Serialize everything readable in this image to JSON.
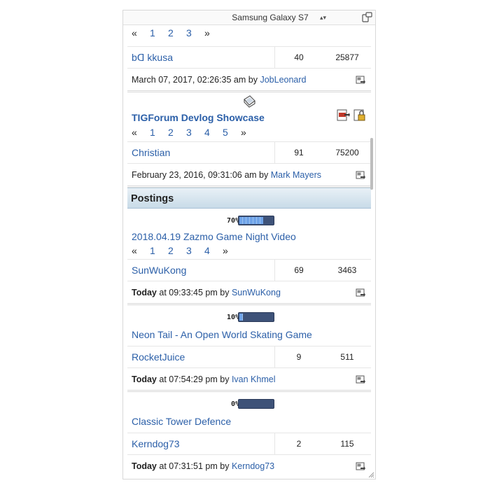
{
  "device": {
    "name": "Samsung Galaxy S7"
  },
  "board1": {
    "pages": [
      "«",
      "1",
      "2",
      "3",
      "»"
    ],
    "stats": {
      "poster": "bᗡ kkusa",
      "replies": "40",
      "views": "25877"
    },
    "last_post": {
      "date": "March 07, 2017, 02:26:35 am by",
      "user": "JobLeonard"
    }
  },
  "board2": {
    "title": "TIGForum Devlog Showcase",
    "pages": [
      "«",
      "1",
      "2",
      "3",
      "4",
      "5",
      "»"
    ],
    "stats": {
      "poster": "Christian",
      "replies": "91",
      "views": "75200"
    },
    "last_post": {
      "date": "February 23, 2016, 09:31:06 am by",
      "user": "Mark Mayers"
    }
  },
  "section_header": "Postings",
  "postings": [
    {
      "percent": 70,
      "percent_label": "70%",
      "title": "2018.04.19 Zazmo Game Night Video",
      "pages": [
        "«",
        "1",
        "2",
        "3",
        "4",
        "»"
      ],
      "poster": "SunWuKong",
      "replies": "69",
      "views": "3463",
      "today": "Today",
      "time": "at 09:33:45 pm by",
      "user": "SunWuKong"
    },
    {
      "percent": 10,
      "percent_label": "10%",
      "title": "Neon Tail - An Open World Skating Game",
      "poster": "RocketJuice",
      "replies": "9",
      "views": "511",
      "today": "Today",
      "time": "at 07:54:29 pm by",
      "user": "Ivan Khmel"
    },
    {
      "percent": 0,
      "percent_label": "0%",
      "title": "Classic Tower Defence",
      "poster": "Kerndog73",
      "replies": "2",
      "views": "115",
      "today": "Today",
      "time": "at 07:31:51 pm by",
      "user": "Kerndog73"
    }
  ]
}
